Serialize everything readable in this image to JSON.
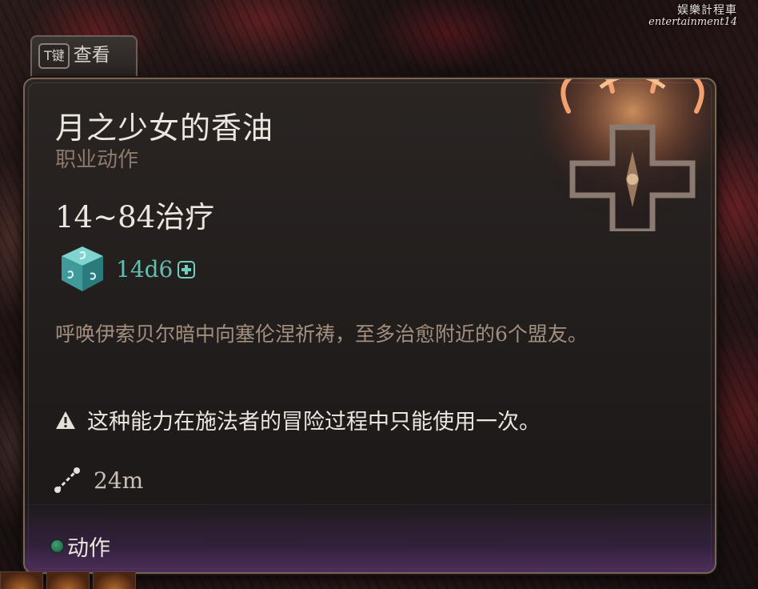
{
  "watermark": {
    "line1": "娱樂計程車",
    "line2": "entertainment14"
  },
  "examine_tab": {
    "key": "T键",
    "label": "查看"
  },
  "tooltip": {
    "title": "月之少女的香油",
    "subtitle": "职业动作",
    "heal_range": "14~84治疗",
    "dice": "14d6",
    "description": "呼唤伊索贝尔暗中向塞伦涅祈祷，至多治愈附近的6个盟友。",
    "warning": "这种能力在施法者的冒险过程中只能使用一次。",
    "range": "24m",
    "action_type": "动作"
  },
  "colors": {
    "title": "#ece6df",
    "subtitle": "#8c7a6a",
    "dice": "#5fc0b2",
    "description": "#a1907f",
    "border": "#7a6552",
    "action_dot": "#2f8a5c"
  },
  "icons": [
    "d6-dice-icon",
    "heal-plus-icon",
    "warning-icon",
    "range-icon",
    "action-dot-icon",
    "selune-emblem-icon"
  ]
}
